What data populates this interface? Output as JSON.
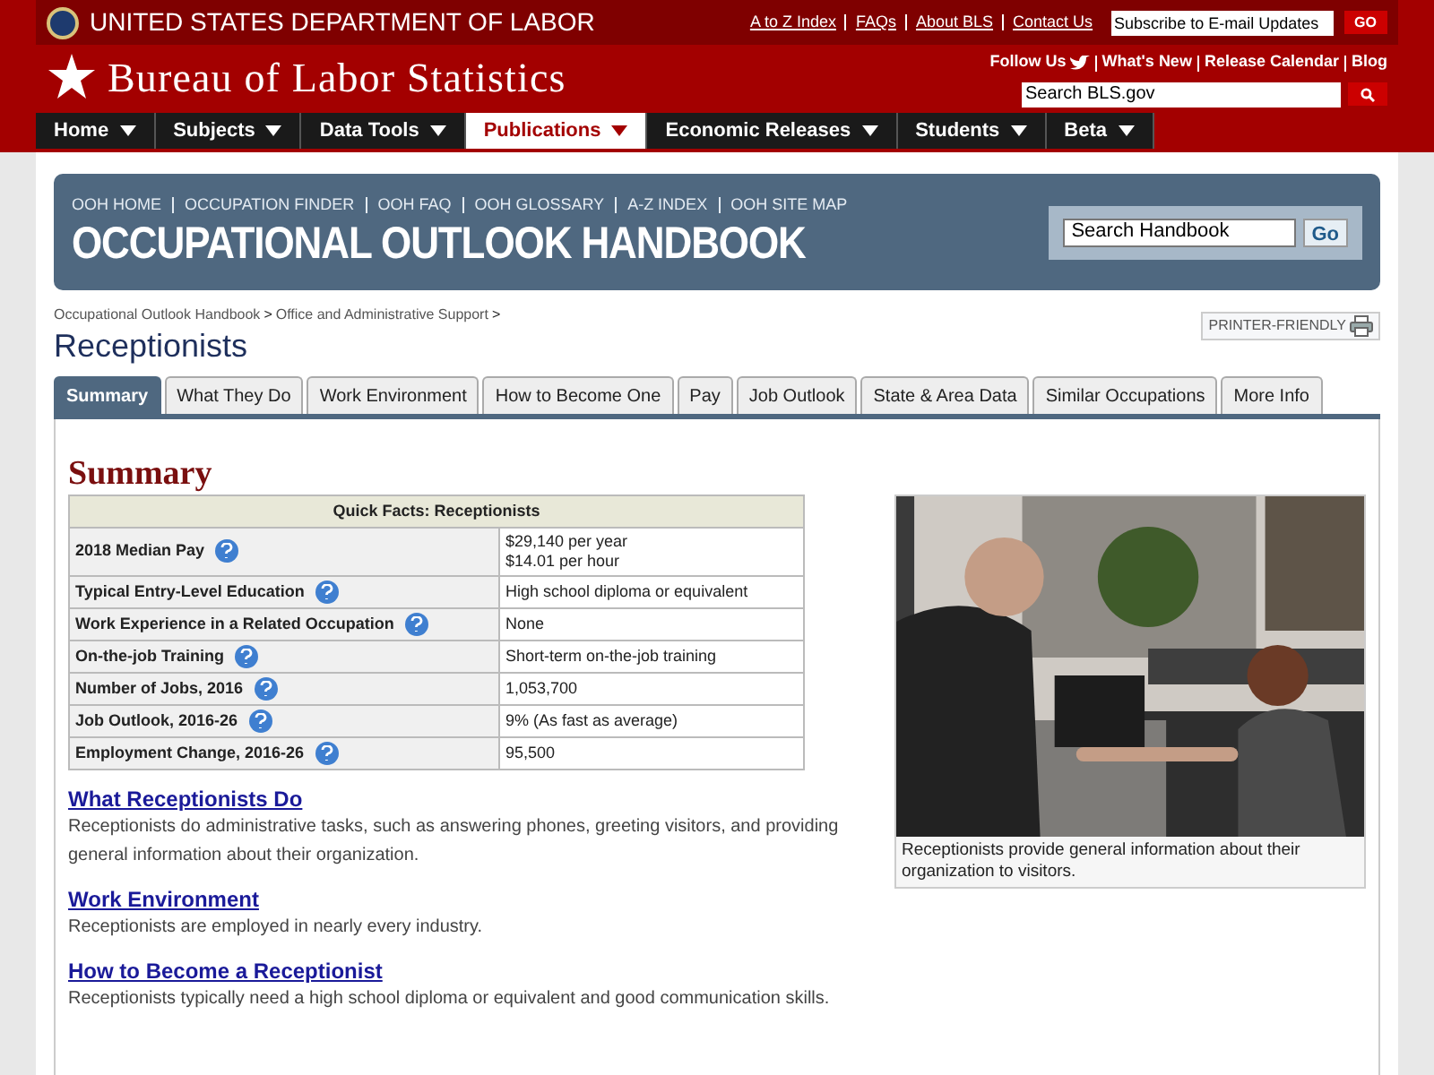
{
  "header": {
    "department": "UNITED STATES DEPARTMENT OF LABOR",
    "top_links": [
      "A to Z Index",
      "FAQs",
      "About BLS",
      "Contact Us"
    ],
    "subscribe_placeholder": "Subscribe to E-mail Updates",
    "subscribe_button": "GO",
    "site_title": "Bureau of Labor Statistics",
    "follow_us": "Follow Us",
    "quick_links": [
      "What's New",
      "Release Calendar",
      "Blog"
    ],
    "search_placeholder": "Search BLS.gov"
  },
  "nav": [
    {
      "label": "Home",
      "selected": false
    },
    {
      "label": "Subjects",
      "selected": false
    },
    {
      "label": "Data Tools",
      "selected": false
    },
    {
      "label": "Publications",
      "selected": true
    },
    {
      "label": "Economic Releases",
      "selected": false
    },
    {
      "label": "Students",
      "selected": false
    },
    {
      "label": "Beta",
      "selected": false
    }
  ],
  "banner": {
    "links": [
      "OOH HOME",
      "OCCUPATION FINDER",
      "OOH FAQ",
      "OOH GLOSSARY",
      "A-Z INDEX",
      "OOH SITE MAP"
    ],
    "title": "OCCUPATIONAL OUTLOOK HANDBOOK",
    "search_placeholder": "Search Handbook",
    "search_button": "Go"
  },
  "breadcrumb": [
    {
      "label": "Occupational Outlook Handbook",
      "separator": ">"
    },
    {
      "label": "Office and Administrative Support",
      "separator": ">"
    }
  ],
  "page_title": "Receptionists",
  "printer_friendly": "PRINTER-FRIENDLY",
  "tabs": [
    {
      "label": "Summary",
      "selected": true
    },
    {
      "label": "What They Do",
      "selected": false
    },
    {
      "label": "Work Environment",
      "selected": false
    },
    {
      "label": "How to Become One",
      "selected": false
    },
    {
      "label": "Pay",
      "selected": false
    },
    {
      "label": "Job Outlook",
      "selected": false
    },
    {
      "label": "State & Area Data",
      "selected": false
    },
    {
      "label": "Similar Occupations",
      "selected": false
    },
    {
      "label": "More Info",
      "selected": false
    }
  ],
  "summary_heading": "Summary",
  "quick_facts": {
    "title": "Quick Facts: Receptionists",
    "rows": [
      {
        "label": "2018 Median Pay",
        "value": [
          "$29,140 per year",
          "$14.01 per hour"
        ]
      },
      {
        "label": "Typical Entry-Level Education",
        "value": [
          "High school diploma or equivalent"
        ]
      },
      {
        "label": "Work Experience in a Related Occupation",
        "value": [
          "None"
        ]
      },
      {
        "label": "On-the-job Training",
        "value": [
          "Short-term on-the-job training"
        ]
      },
      {
        "label": "Number of Jobs, 2016",
        "value": [
          "1,053,700"
        ]
      },
      {
        "label": "Job Outlook, 2016-26",
        "value": [
          "9% (As fast as average)"
        ]
      },
      {
        "label": "Employment Change, 2016-26",
        "value": [
          "95,500"
        ]
      }
    ]
  },
  "sections": [
    {
      "heading": "What Receptionists Do",
      "text": "Receptionists do administrative tasks, such as answering phones, greeting visitors, and providing general information about their organization."
    },
    {
      "heading": "Work Environment",
      "text": "Receptionists are employed in nearly every industry."
    },
    {
      "heading": "How to Become a Receptionist",
      "text": "Receptionists typically need a high school diploma or equivalent and good communication skills."
    }
  ],
  "photo": {
    "kind": "picture",
    "caption": "Receptionists provide general information about their organization to visitors."
  }
}
